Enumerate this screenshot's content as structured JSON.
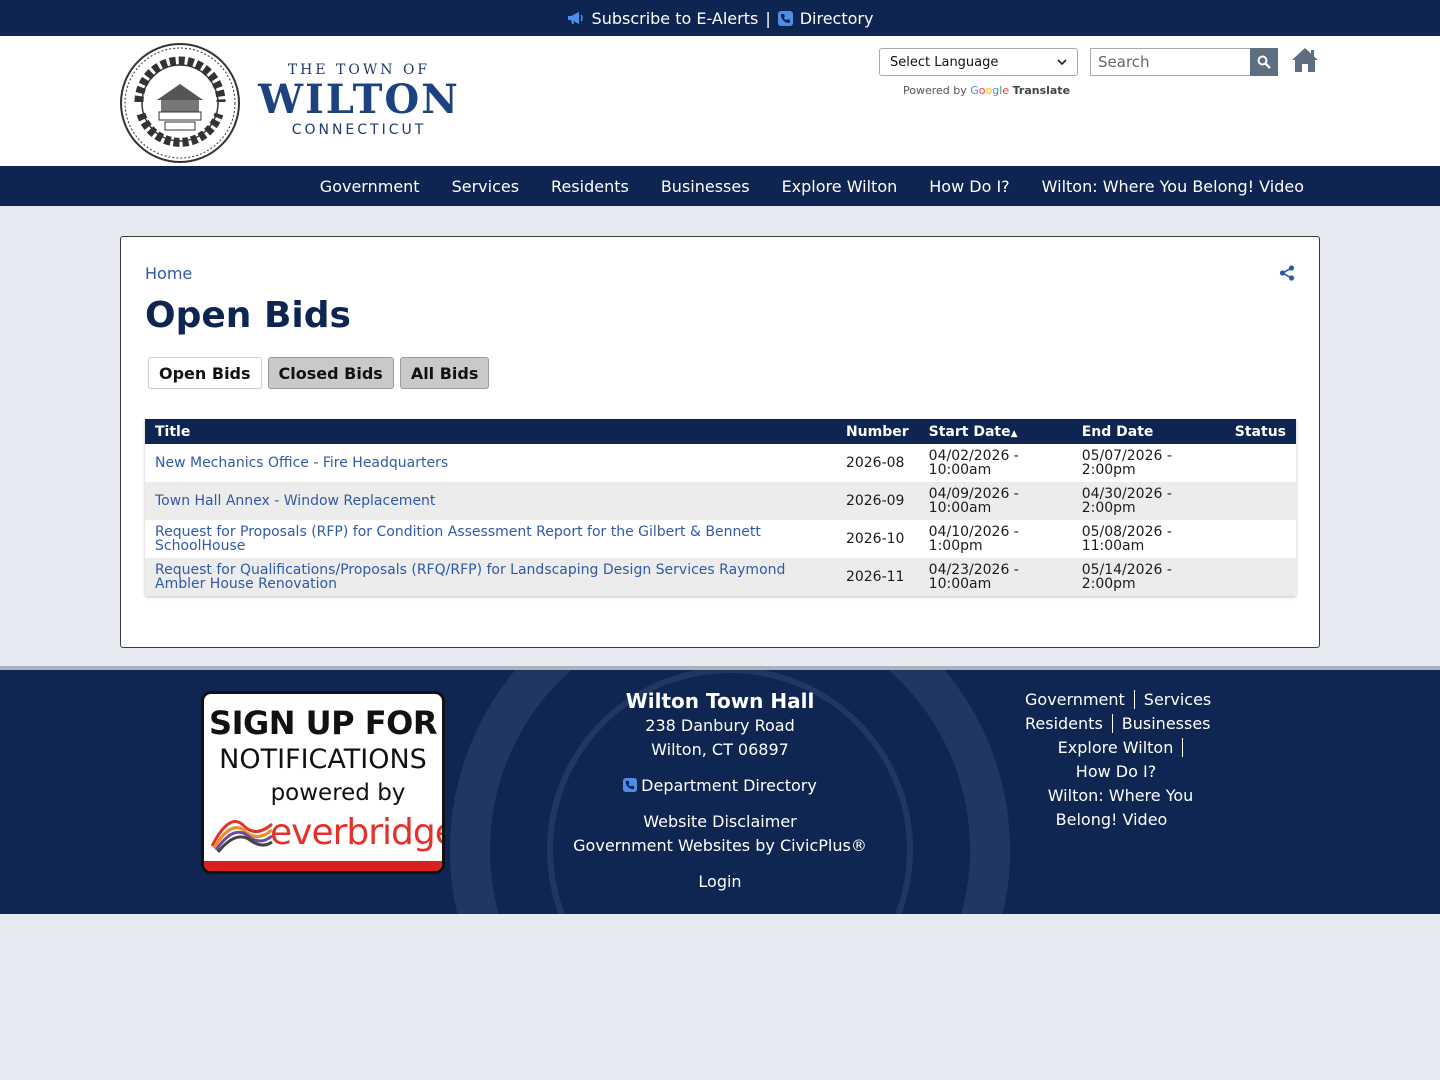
{
  "topbar": {
    "alerts_label": "Subscribe to E-Alerts",
    "separator": "|",
    "directory_label": "Directory"
  },
  "header": {
    "wordmark_top": "THE TOWN OF",
    "wordmark_main": "WILTON",
    "wordmark_bottom": "CONNECTICUT",
    "language_select": "Select Language",
    "powered_by": "Powered by",
    "google": [
      "G",
      "o",
      "o",
      "g",
      "l",
      "e"
    ],
    "translate": "Translate",
    "search_placeholder": "Search"
  },
  "nav": {
    "items": [
      "Government",
      "Services",
      "Residents",
      "Businesses",
      "Explore Wilton",
      "How Do I?",
      "Wilton: Where You Belong! Video"
    ]
  },
  "content": {
    "breadcrumb": "Home",
    "page_title": "Open Bids",
    "tabs": [
      "Open Bids",
      "Closed Bids",
      "All Bids"
    ],
    "table": {
      "headers": [
        "Title",
        "Number",
        "Start Date",
        "End Date",
        "Status"
      ],
      "sort_indicator": "▲",
      "rows": [
        {
          "title": "New Mechanics Office - Fire Headquarters",
          "number": "2026-08",
          "start": "04/02/2026 - 10:00am",
          "end": "05/07/2026 - 2:00pm",
          "status": ""
        },
        {
          "title": "Town Hall Annex - Window Replacement",
          "number": "2026-09",
          "start": "04/09/2026 - 10:00am",
          "end": "04/30/2026 - 2:00pm",
          "status": ""
        },
        {
          "title": "Request for Proposals (RFP) for Condition Assessment Report for the Gilbert & Bennett SchoolHouse",
          "number": "2026-10",
          "start": "04/10/2026 - 1:00pm",
          "end": "05/08/2026 - 11:00am",
          "status": ""
        },
        {
          "title": "Request for Qualifications/Proposals (RFQ/RFP) for Landscaping Design Services Raymond Ambler House Renovation",
          "number": "2026-11",
          "start": "04/23/2026 - 10:00am",
          "end": "05/14/2026 - 2:00pm",
          "status": ""
        }
      ]
    }
  },
  "footer": {
    "badge": {
      "line1": "SIGN UP FOR",
      "line2": "NOTIFICATIONS",
      "line3": "powered by",
      "brand": "everbridge"
    },
    "hall_name": "Wilton Town Hall",
    "address1": "238 Danbury Road",
    "address2": "Wilton, CT 06897",
    "dept_directory": "Department Directory",
    "disclaimer": "Website Disclaimer",
    "civicplus": "Government Websites by CivicPlus®",
    "login": "Login",
    "links": [
      "Government",
      "Services",
      "Residents",
      "Businesses",
      "Explore Wilton",
      "How Do I?",
      "Wilton: Where You Belong! Video"
    ]
  },
  "colors": {
    "navy": "#0d2550",
    "link": "#2f5aa8",
    "accent_blue": "#4d8ee8",
    "everbridge_red": "#e4322b"
  }
}
